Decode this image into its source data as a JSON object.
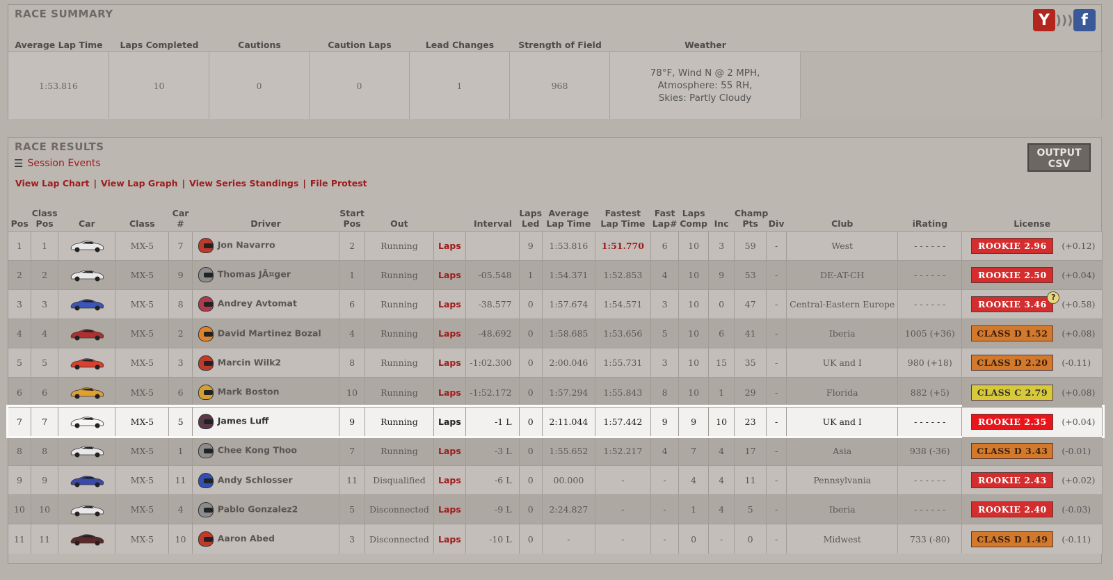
{
  "summary": {
    "title": "RACE SUMMARY",
    "headers": [
      "Average Lap Time",
      "Laps Completed",
      "Cautions",
      "Caution Laps",
      "Lead Changes",
      "Strength of Field",
      "Weather"
    ],
    "values": [
      "1:53.816",
      "10",
      "0",
      "0",
      "1",
      "968"
    ],
    "weather_lines": [
      "78°F, Wind N @ 2 MPH,",
      "Atmosphere: 55 RH,",
      "Skies: Partly Cloudy"
    ]
  },
  "social": {
    "icons": [
      "yahoo-icon",
      "sound-icon",
      "facebook-icon"
    ],
    "yahoo_glyph": "Y",
    "wave_glyph": ")))",
    "facebook_glyph": "f"
  },
  "results": {
    "title": "RACE RESULTS",
    "session_events": "Session Events",
    "links": [
      "View Lap Chart",
      "View Lap Graph",
      "View Series Standings",
      "File Protest"
    ],
    "link_separator": "|",
    "output_csv": "OUTPUT\nCSV",
    "output_csv_lines": [
      "OUTPUT",
      "CSV"
    ],
    "columns": [
      "Pos",
      "Class Pos",
      "Car",
      "Class",
      "Car #",
      "Driver",
      "Start Pos",
      "Out",
      "",
      "Interval",
      "Laps Led",
      "Average Lap Time",
      "Fastest Lap Time",
      "Fast Lap#",
      "Laps Comp",
      "Inc",
      "Champ Pts",
      "Div",
      "Club",
      "iRating",
      "License"
    ],
    "rows": [
      {
        "pos": "1",
        "cpos": "1",
        "car_color": "#e8e8e8",
        "cls": "MX-5",
        "num": "7",
        "helmet": "#c0392b",
        "driver": "Jon Navarro",
        "start": "2",
        "out": "Running",
        "laps": "Laps",
        "interval": "",
        "led": "9",
        "avg": "1:53.816",
        "fast": "1:51.770",
        "fast_best": true,
        "fastlap": "6",
        "comp": "10",
        "inc": "3",
        "pts": "59",
        "div": "-",
        "club": "West",
        "irating": "- - - - - -",
        "license": "ROOKIE 2.96",
        "lic_color": "#d42d2d",
        "delta": "(+0.12)"
      },
      {
        "pos": "2",
        "cpos": "2",
        "car_color": "#e8e8e8",
        "cls": "MX-5",
        "num": "9",
        "helmet": "#8c8c8c",
        "driver": "Thomas JÃ¤ger",
        "start": "1",
        "out": "Running",
        "laps": "Laps",
        "interval": "-05.548",
        "led": "1",
        "avg": "1:54.371",
        "fast": "1:52.853",
        "fast_best": false,
        "fastlap": "4",
        "comp": "10",
        "inc": "9",
        "pts": "53",
        "div": "-",
        "club": "DE-AT-CH",
        "irating": "- - - - - -",
        "license": "ROOKIE 2.50",
        "lic_color": "#d42d2d",
        "delta": "(+0.04)"
      },
      {
        "pos": "3",
        "cpos": "3",
        "car_color": "#3b55b8",
        "cls": "MX-5",
        "num": "8",
        "helmet": "#b03a4a",
        "driver": "Andrey Avtomat",
        "start": "6",
        "out": "Running",
        "laps": "Laps",
        "interval": "-38.577",
        "led": "0",
        "avg": "1:57.674",
        "fast": "1:54.571",
        "fast_best": false,
        "fastlap": "3",
        "comp": "10",
        "inc": "0",
        "pts": "47",
        "div": "-",
        "club": "Central-Eastern Europe",
        "irating": "- - - - - -",
        "license": "ROOKIE 3.46",
        "lic_color": "#d42d2d",
        "delta": "(+0.58)",
        "qmark": "?"
      },
      {
        "pos": "4",
        "cpos": "4",
        "car_color": "#b03030",
        "cls": "MX-5",
        "num": "2",
        "helmet": "#e0822a",
        "driver": "David Martinez Bozal",
        "start": "4",
        "out": "Running",
        "laps": "Laps",
        "interval": "-48.692",
        "led": "0",
        "avg": "1:58.685",
        "fast": "1:53.656",
        "fast_best": false,
        "fastlap": "5",
        "comp": "10",
        "inc": "6",
        "pts": "41",
        "div": "-",
        "club": "Iberia",
        "irating": "1005 (+36)",
        "license": "CLASS D 1.52",
        "lic_color": "#d2792c",
        "delta": "(+0.08)"
      },
      {
        "pos": "5",
        "cpos": "5",
        "car_color": "#d84030",
        "cls": "MX-5",
        "num": "3",
        "helmet": "#c0392b",
        "driver": "Marcin Wilk2",
        "start": "8",
        "out": "Running",
        "laps": "Laps",
        "interval": "-1:02.300",
        "led": "0",
        "avg": "2:00.046",
        "fast": "1:55.731",
        "fast_best": false,
        "fastlap": "3",
        "comp": "10",
        "inc": "15",
        "pts": "35",
        "div": "-",
        "club": "UK and I",
        "irating": "980 (+18)",
        "license": "CLASS D 2.20",
        "lic_color": "#d2792c",
        "delta": "(-0.11)"
      },
      {
        "pos": "6",
        "cpos": "6",
        "car_color": "#e0a030",
        "cls": "MX-5",
        "num": "6",
        "helmet": "#d4a030",
        "driver": "Mark Boston",
        "start": "10",
        "out": "Running",
        "laps": "Laps",
        "interval": "-1:52.172",
        "led": "0",
        "avg": "1:57.294",
        "fast": "1:55.843",
        "fast_best": false,
        "fastlap": "8",
        "comp": "10",
        "inc": "1",
        "pts": "29",
        "div": "-",
        "club": "Florida",
        "irating": "882 (+5)",
        "license": "CLASS C 2.79",
        "lic_color": "#d8c93a",
        "delta": "(+0.08)"
      },
      {
        "pos": "7",
        "cpos": "7",
        "car_color": "#f5f5f5",
        "cls": "MX-5",
        "num": "5",
        "helmet": "#5a3a4a",
        "driver": "James Luff",
        "start": "9",
        "out": "Running",
        "laps": "Laps",
        "interval": "-1 L",
        "led": "0",
        "avg": "2:11.044",
        "fast": "1:57.442",
        "fast_best": false,
        "fastlap": "9",
        "comp": "9",
        "inc": "10",
        "pts": "23",
        "div": "-",
        "club": "UK and I",
        "irating": "- - - - - -",
        "license": "ROOKIE 2.35",
        "lic_color": "#e8151b",
        "delta": "(+0.04)",
        "highlight": true
      },
      {
        "pos": "8",
        "cpos": "8",
        "car_color": "#e8e8e8",
        "cls": "MX-5",
        "num": "1",
        "helmet": "#8c8c8c",
        "driver": "Chee Kong Thoo",
        "start": "7",
        "out": "Running",
        "laps": "Laps",
        "interval": "-3 L",
        "led": "0",
        "avg": "1:55.652",
        "fast": "1:52.217",
        "fast_best": false,
        "fastlap": "4",
        "comp": "7",
        "inc": "4",
        "pts": "17",
        "div": "-",
        "club": "Asia",
        "irating": "938 (-36)",
        "license": "CLASS D 3.43",
        "lic_color": "#d2792c",
        "delta": "(-0.01)"
      },
      {
        "pos": "9",
        "cpos": "9",
        "car_color": "#3b4aa8",
        "cls": "MX-5",
        "num": "11",
        "helmet": "#3050b8",
        "driver": "Andy Schlosser",
        "start": "11",
        "out": "Disqualified",
        "laps": "Laps",
        "interval": "-6 L",
        "led": "0",
        "avg": "00.000",
        "fast": "-",
        "fast_best": false,
        "fastlap": "-",
        "comp": "4",
        "inc": "4",
        "pts": "11",
        "div": "-",
        "club": "Pennsylvania",
        "irating": "- - - - - -",
        "license": "ROOKIE 2.43",
        "lic_color": "#d42d2d",
        "delta": "(+0.02)"
      },
      {
        "pos": "10",
        "cpos": "10",
        "car_color": "#e8e8e8",
        "cls": "MX-5",
        "num": "4",
        "helmet": "#8c8c8c",
        "driver": "Pablo Gonzalez2",
        "start": "5",
        "out": "Disconnected",
        "laps": "Laps",
        "interval": "-9 L",
        "led": "0",
        "avg": "2:24.827",
        "fast": "-",
        "fast_best": false,
        "fastlap": "-",
        "comp": "1",
        "inc": "4",
        "pts": "5",
        "div": "-",
        "club": "Iberia",
        "irating": "- - - - - -",
        "license": "ROOKIE 2.40",
        "lic_color": "#d42d2d",
        "delta": "(-0.03)"
      },
      {
        "pos": "11",
        "cpos": "11",
        "car_color": "#5a2a2a",
        "cls": "MX-5",
        "num": "10",
        "helmet": "#c0392b",
        "driver": "Aaron Abed",
        "start": "3",
        "out": "Disconnected",
        "laps": "Laps",
        "interval": "-10 L",
        "led": "0",
        "avg": "-",
        "fast": "-",
        "fast_best": false,
        "fastlap": "-",
        "comp": "0",
        "inc": "-",
        "pts": "0",
        "div": "-",
        "club": "Midwest",
        "irating": "733 (-80)",
        "license": "CLASS D 1.49",
        "lic_color": "#d2792c",
        "delta": "(-0.11)"
      }
    ]
  }
}
